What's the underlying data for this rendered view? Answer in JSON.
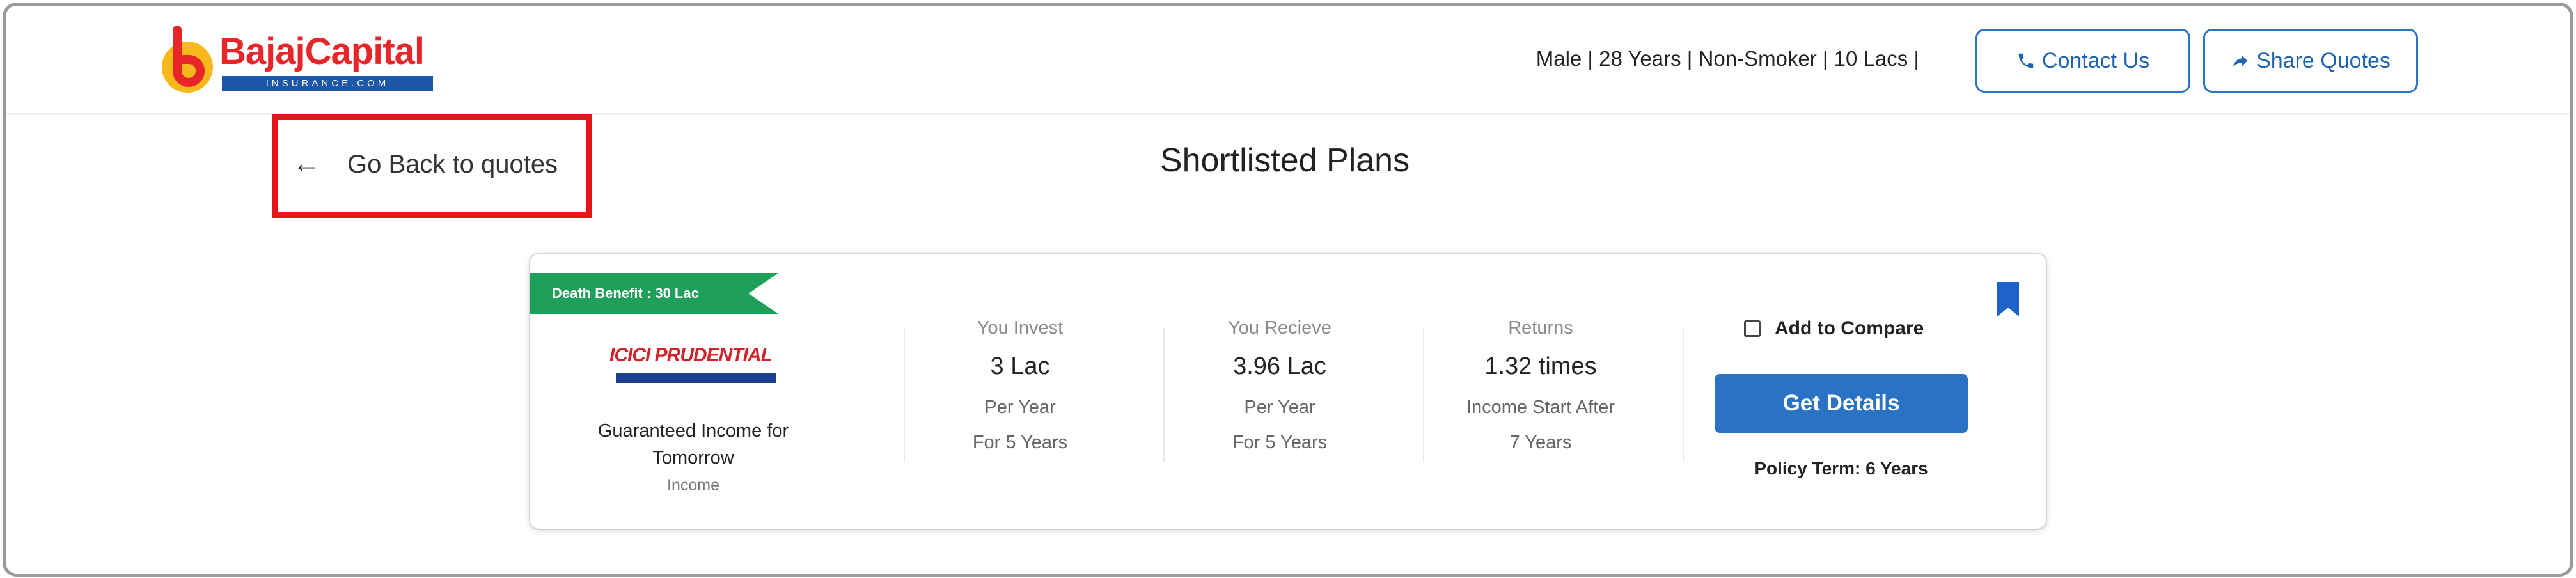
{
  "brand": {
    "name": "BajajCapital",
    "sub": "INSURANCE.COM",
    "color_primary": "#e8262a",
    "color_secondary": "#1f57a8"
  },
  "header": {
    "profile_summary": "Male |  28 Years |  Non-Smoker |  10 Lacs |",
    "contact_label": "Contact Us",
    "contact_icon": "phone-icon",
    "share_label": "Share Quotes",
    "share_icon": "share-icon"
  },
  "nav": {
    "back_arrow": "←",
    "back_label": "Go Back to quotes"
  },
  "page": {
    "title": "Shortlisted Plans"
  },
  "plan": {
    "ribbon": "Death Benefit : 30 Lac",
    "insurer_logo_text": "ICICI PRUDENTIAL",
    "name": "Guaranteed Income for Tomorrow",
    "type": "Income",
    "invest": {
      "label": "You Invest",
      "value": "3 Lac",
      "sub1": "Per Year",
      "sub2": "For 5 Years"
    },
    "receive": {
      "label": "You Recieve",
      "value": "3.96 Lac",
      "sub1": "Per Year",
      "sub2": "For 5 Years"
    },
    "returns": {
      "label": "Returns",
      "value": "1.32 times",
      "sub1": "Income Start After",
      "sub2": "7 Years"
    },
    "compare_label": "Add to Compare",
    "compare_checked": false,
    "cta_label": "Get Details",
    "policy_term": "Policy Term: 6 Years",
    "bookmark_icon": "bookmark-icon",
    "accent_color": "#2a73c4",
    "ribbon_color": "#1ea05a"
  }
}
